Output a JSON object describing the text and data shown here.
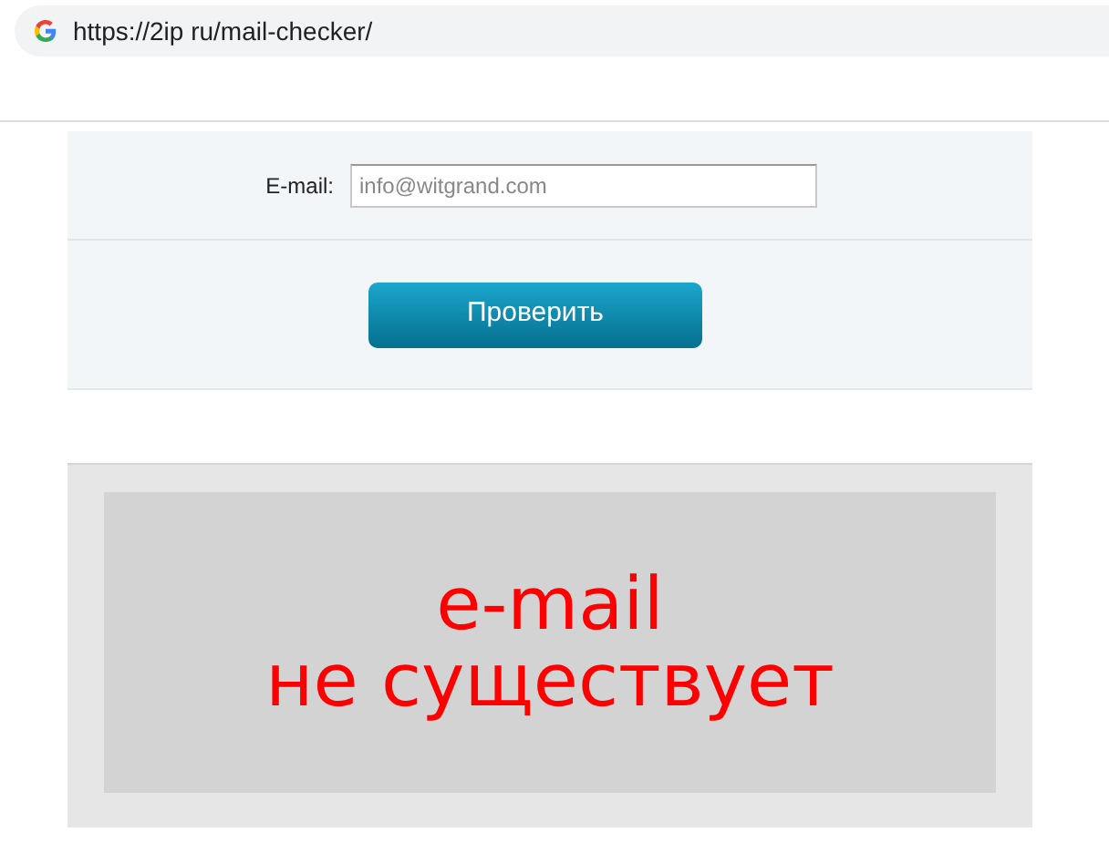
{
  "address_bar": {
    "url": "https://2ip ru/mail-checker/"
  },
  "form": {
    "email_label": "E-mail:",
    "email_placeholder": "info@witgrand.com",
    "submit_button": "Проверить"
  },
  "result": {
    "lines": [
      "e-mail",
      "не существует"
    ]
  }
}
